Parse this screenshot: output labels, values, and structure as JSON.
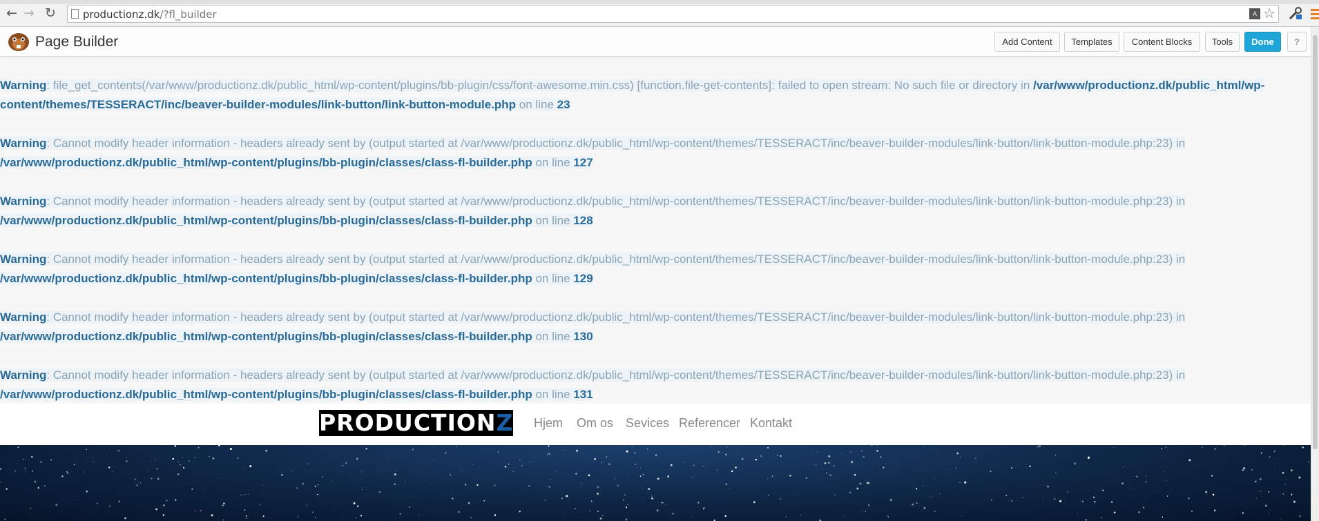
{
  "browser": {
    "url_host": "productionz.dk",
    "url_path": "/?fl_builder"
  },
  "builder": {
    "title": "Page Builder",
    "buttons": {
      "add_content": "Add Content",
      "templates": "Templates",
      "content_blocks": "Content Blocks",
      "tools": "Tools",
      "done": "Done",
      "help": "?"
    }
  },
  "warnings": [
    {
      "label": "Warning",
      "message": ": file_get_contents(/var/www/productionz.dk/public_html/wp-content/plugins/bb-plugin/css/font-awesome.min.css) [function.file-get-contents]: failed to open stream: No such file or directory in ",
      "file": "/var/www/productionz.dk/public_html/wp-content/themes/TESSERACT/inc/beaver-builder-modules/link-button/link-button-module.php",
      "on_line": " on line ",
      "line": "23"
    },
    {
      "label": "Warning",
      "message": ": Cannot modify header information - headers already sent by (output started at /var/www/productionz.dk/public_html/wp-content/themes/TESSERACT/inc/beaver-builder-modules/link-button/link-button-module.php:23) in ",
      "file": "/var/www/productionz.dk/public_html/wp-content/plugins/bb-plugin/classes/class-fl-builder.php",
      "on_line": " on line ",
      "line": "127"
    },
    {
      "label": "Warning",
      "message": ": Cannot modify header information - headers already sent by (output started at /var/www/productionz.dk/public_html/wp-content/themes/TESSERACT/inc/beaver-builder-modules/link-button/link-button-module.php:23) in ",
      "file": "/var/www/productionz.dk/public_html/wp-content/plugins/bb-plugin/classes/class-fl-builder.php",
      "on_line": " on line ",
      "line": "128"
    },
    {
      "label": "Warning",
      "message": ": Cannot modify header information - headers already sent by (output started at /var/www/productionz.dk/public_html/wp-content/themes/TESSERACT/inc/beaver-builder-modules/link-button/link-button-module.php:23) in ",
      "file": "/var/www/productionz.dk/public_html/wp-content/plugins/bb-plugin/classes/class-fl-builder.php",
      "on_line": " on line ",
      "line": "129"
    },
    {
      "label": "Warning",
      "message": ": Cannot modify header information - headers already sent by (output started at /var/www/productionz.dk/public_html/wp-content/themes/TESSERACT/inc/beaver-builder-modules/link-button/link-button-module.php:23) in ",
      "file": "/var/www/productionz.dk/public_html/wp-content/plugins/bb-plugin/classes/class-fl-builder.php",
      "on_line": " on line ",
      "line": "130"
    },
    {
      "label": "Warning",
      "message": ": Cannot modify header information - headers already sent by (output started at /var/www/productionz.dk/public_html/wp-content/themes/TESSERACT/inc/beaver-builder-modules/link-button/link-button-module.php:23) in ",
      "file": "/var/www/productionz.dk/public_html/wp-content/plugins/bb-plugin/classes/class-fl-builder.php",
      "on_line": " on line ",
      "line": "131"
    }
  ],
  "site": {
    "logo_main": "PRODUCTION",
    "logo_accent": "Z",
    "nav": [
      "Hjem",
      "Om os",
      "Sevices",
      "Referencer",
      "Kontakt"
    ]
  },
  "colors": {
    "done_button": "#1fa6d8",
    "warning_path": "#2a6a96",
    "warning_text": "#8aa4b6",
    "logo_accent": "#1a5ea8"
  },
  "icons": {
    "back": "back-arrow-icon",
    "forward": "forward-arrow-icon",
    "reload": "reload-icon",
    "page": "page-icon",
    "translate": "translate-icon",
    "bookmark": "star-icon",
    "extension": "extension-icon",
    "menu": "menu-icon",
    "builder_logo": "beaver-logo-icon"
  }
}
